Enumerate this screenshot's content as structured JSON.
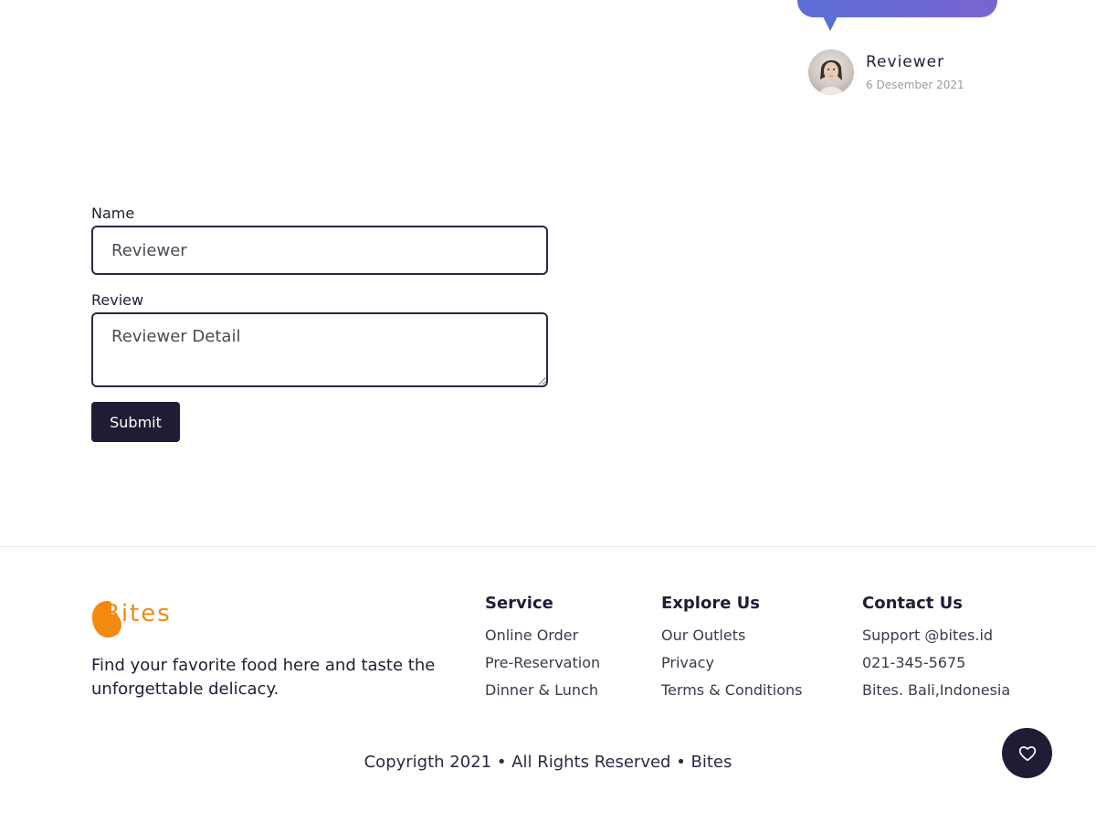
{
  "review_card": {
    "reviewer_name": "Reviewer",
    "date": "6 Desember 2021",
    "bubble_color": "#6a6cd4"
  },
  "form": {
    "name_label": "Name",
    "name_placeholder": "Reviewer",
    "review_label": "Review",
    "review_placeholder": "Reviewer Detail",
    "submit_label": "Submit"
  },
  "footer": {
    "logo_text": "Bites",
    "tagline": "Find your favorite food here and taste the unforgettable delicacy.",
    "columns": [
      {
        "title": "Service",
        "links": [
          "Online Order",
          "Pre-Reservation",
          "Dinner & Lunch"
        ]
      },
      {
        "title": "Explore Us",
        "links": [
          "Our Outlets",
          "Privacy",
          "Terms & Conditions"
        ]
      },
      {
        "title": "Contact Us",
        "links": [
          "Support @bites.id",
          "021-345-5675",
          "Bites. Bali,Indonesia"
        ]
      }
    ],
    "copyright": "Copyrigth 2021 • All Rights Reserved • Bites"
  },
  "fab": {
    "icon": "heart-icon"
  },
  "colors": {
    "primary_dark": "#1f1d36",
    "brand_orange": "#f28a12"
  }
}
